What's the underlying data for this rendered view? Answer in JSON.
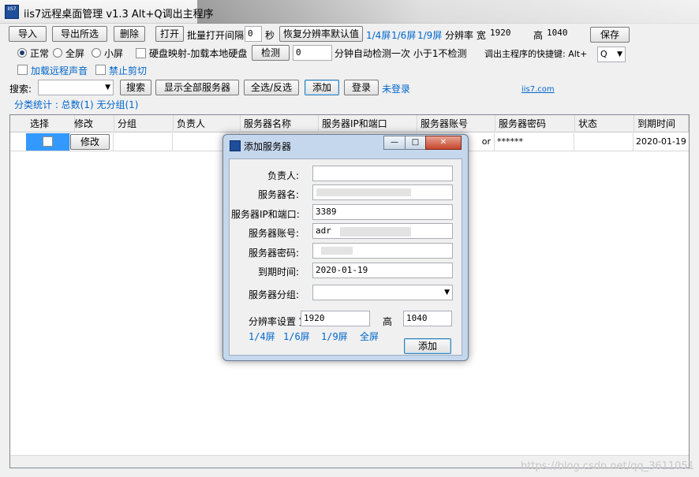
{
  "window": {
    "title": "iis7远程桌面管理 v1.3 Alt+Q调出主程序",
    "icon": "IIS7 logo"
  },
  "toolbar1": {
    "import": "导入",
    "export": "导出所选",
    "delete": "删除",
    "open": "打开",
    "batch_label": "批量打开间隔",
    "batch_value": "0",
    "seconds": "秒",
    "restore_res": "恢复分辨率默认值",
    "screen_quarter": "1/4屏",
    "screen_sixth": "1/6屏",
    "screen_ninth": "1/9屏",
    "res_label": "分辨率 宽",
    "width_value": "1920",
    "height_label": "高",
    "height_value": "1040",
    "save": "保存"
  },
  "toolbar2": {
    "mode_normal": "正常",
    "mode_full": "全屏",
    "mode_small": "小屏",
    "disk_map": "硬盘映射-加载本地硬盘",
    "detect": "检测",
    "detect_value": "0",
    "auto_detect": "分钟自动检测一次 小于1不检测",
    "hotkey_label": "调出主程序的快捷键: Alt+",
    "hotkey_value": "Q"
  },
  "toolbar3": {
    "load_sound": "加载远程声音",
    "disable_clip": "禁止剪切"
  },
  "toolbar4": {
    "search_label": "搜索:",
    "search_btn": "搜索",
    "show_all": "显示全部服务器",
    "select_all": "全选/反选",
    "add": "添加",
    "login": "登录",
    "not_logged": "未登录",
    "site": "iis7.com"
  },
  "stats": {
    "text": "分类统计 : 总数(1) 无分组(1)"
  },
  "table": {
    "headers": [
      "选择",
      "修改",
      "分组",
      "负责人",
      "服务器名称",
      "服务器IP和端口",
      "服务器账号",
      "服务器密码",
      "状态",
      "到期时间"
    ],
    "row": {
      "edit": "修改",
      "account_tail": "or",
      "password": "******",
      "expiry": "2020-01-19"
    }
  },
  "dialog": {
    "title": "添加服务器",
    "owner_label": "负责人:",
    "owner_value": "",
    "name_label": "服务器名:",
    "ip_label": "服务器IP和端口:",
    "ip_value": "3389",
    "account_label": "服务器账号:",
    "account_value": "adr",
    "password_label": "服务器密码:",
    "expiry_label": "到期时间:",
    "expiry_value": "2020-01-19",
    "group_label": "服务器分组:",
    "res_label": "分辨率设置 宽:",
    "res_width": "1920",
    "res_height_label": "高",
    "res_height": "1040",
    "q_quarter": "1/4屏",
    "q_sixth": "1/6屏",
    "q_ninth": "1/9屏",
    "q_full": "全屏",
    "add_btn": "添加"
  },
  "watermark": "https://blog.csdn.net/qq_3611051"
}
